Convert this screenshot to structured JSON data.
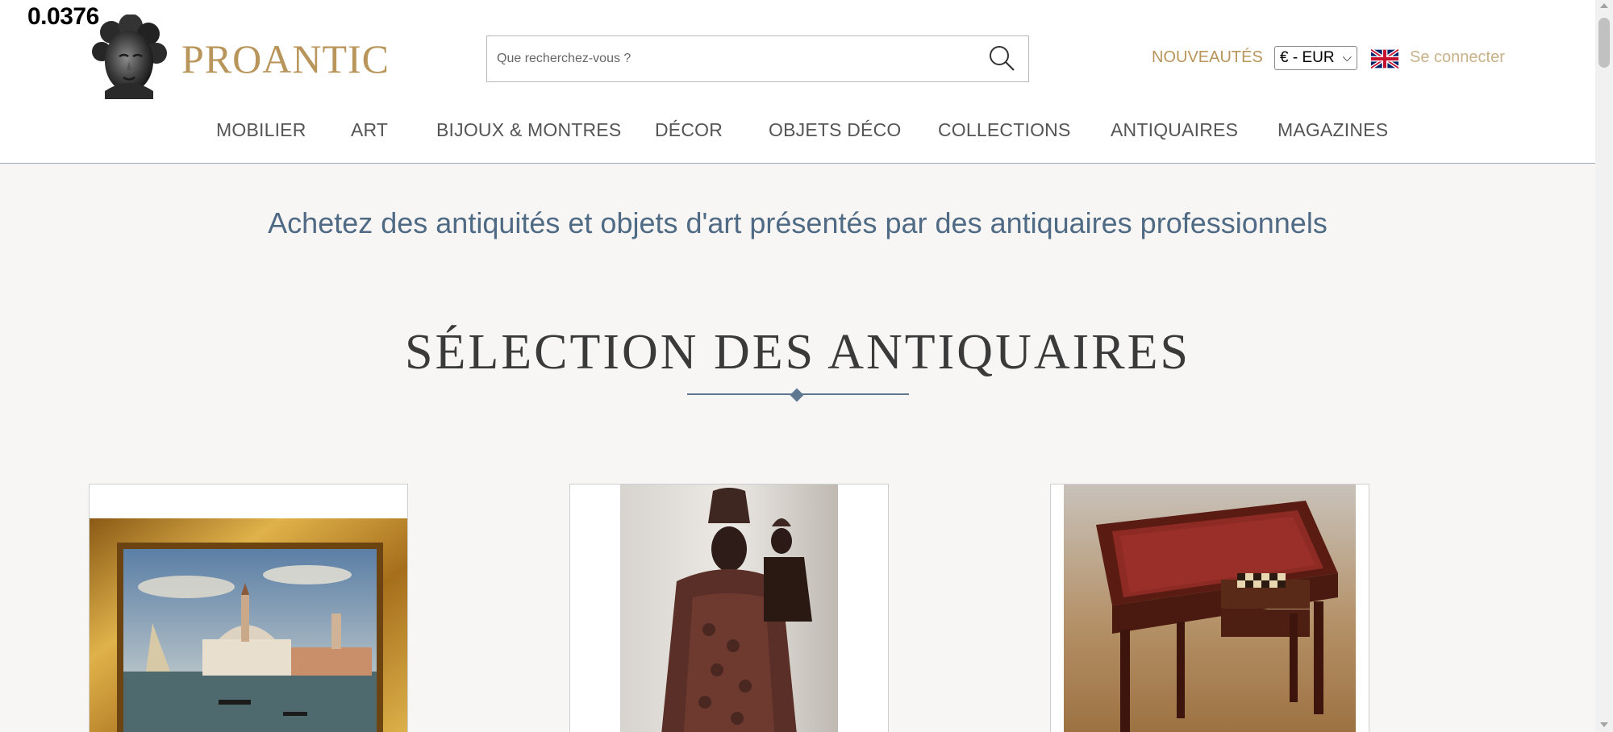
{
  "overlay": {
    "debug_value": "0.0376"
  },
  "brand": {
    "name": "PROANTIC",
    "logo_icon": "classical-bust-logo-icon",
    "accent_color": "#b8955a"
  },
  "search": {
    "placeholder": "Que recherchez-vous ?",
    "value": "",
    "icon": "search-icon"
  },
  "header_actions": {
    "new_label": "NOUVEAUTÉS",
    "currency_selected": "€ - EUR",
    "language_icon": "uk-flag-icon",
    "login_label": "Se connecter"
  },
  "nav": {
    "items": [
      {
        "label": "MOBILIER"
      },
      {
        "label": "ART"
      },
      {
        "label": "BIJOUX & MONTRES"
      },
      {
        "label": "DÉCOR"
      },
      {
        "label": "OBJETS DÉCO"
      },
      {
        "label": "COLLECTIONS"
      },
      {
        "label": "ANTIQUAIRES"
      },
      {
        "label": "MAGAZINES"
      }
    ]
  },
  "main": {
    "tagline": "Achetez des antiquités et objets d'art présentés par des antiquaires professionnels",
    "section_title": "SÉLECTION DES ANTIQUAIRES",
    "products": [
      {
        "image": "venice-painting-gilt-frame"
      },
      {
        "image": "carved-wooden-madonna-statue"
      },
      {
        "image": "mahogany-game-table-desk"
      }
    ]
  },
  "colors": {
    "tagline": "#4f6a84",
    "nav_text": "#555555",
    "login": "#c9b289",
    "background": "#f7f6f4"
  }
}
